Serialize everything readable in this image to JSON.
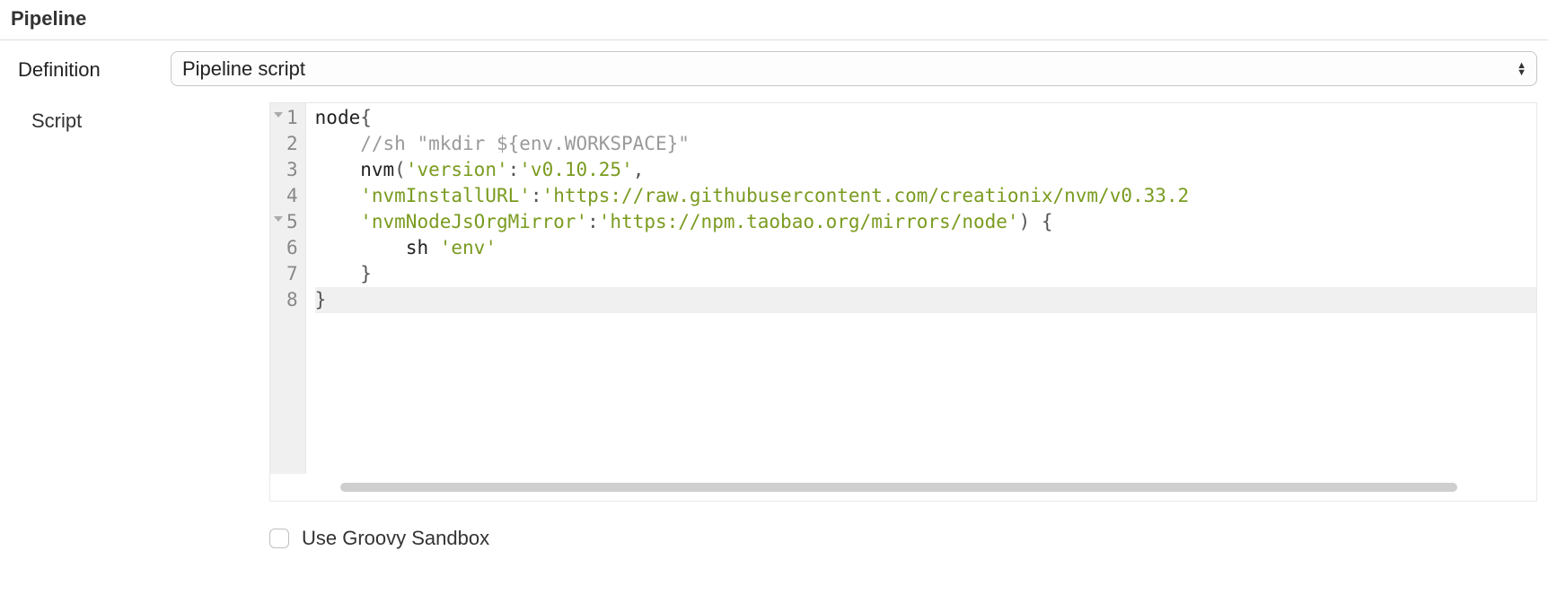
{
  "section": {
    "title": "Pipeline"
  },
  "definition": {
    "label": "Definition",
    "selected": "Pipeline script",
    "options": [
      "Pipeline script"
    ]
  },
  "script": {
    "label": "Script",
    "active_line": 8,
    "lines": [
      {
        "n": 1,
        "fold": true,
        "tokens": [
          {
            "t": "node",
            "c": "tok-kw"
          },
          {
            "t": "{",
            "c": "tok-punc"
          }
        ]
      },
      {
        "n": 2,
        "fold": false,
        "tokens": [
          {
            "t": "    ",
            "c": "tok-plain"
          },
          {
            "t": "//sh \"mkdir ${env.WORKSPACE}\"",
            "c": "tok-comment"
          }
        ]
      },
      {
        "n": 3,
        "fold": false,
        "tokens": [
          {
            "t": "    ",
            "c": "tok-plain"
          },
          {
            "t": "nvm",
            "c": "tok-call"
          },
          {
            "t": "(",
            "c": "tok-punc"
          },
          {
            "t": "'version'",
            "c": "tok-str"
          },
          {
            "t": ":",
            "c": "tok-punc"
          },
          {
            "t": "'v0.10.25'",
            "c": "tok-str"
          },
          {
            "t": ",",
            "c": "tok-punc"
          }
        ]
      },
      {
        "n": 4,
        "fold": false,
        "tokens": [
          {
            "t": "    ",
            "c": "tok-plain"
          },
          {
            "t": "'nvmInstallURL'",
            "c": "tok-str"
          },
          {
            "t": ":",
            "c": "tok-punc"
          },
          {
            "t": "'https://raw.githubusercontent.com/creationix/nvm/v0.33.2",
            "c": "tok-str"
          }
        ]
      },
      {
        "n": 5,
        "fold": true,
        "tokens": [
          {
            "t": "    ",
            "c": "tok-plain"
          },
          {
            "t": "'nvmNodeJsOrgMirror'",
            "c": "tok-str"
          },
          {
            "t": ":",
            "c": "tok-punc"
          },
          {
            "t": "'https://npm.taobao.org/mirrors/node'",
            "c": "tok-str"
          },
          {
            "t": ")",
            "c": "tok-punc"
          },
          {
            "t": " ",
            "c": "tok-plain"
          },
          {
            "t": "{",
            "c": "tok-punc"
          }
        ]
      },
      {
        "n": 6,
        "fold": false,
        "tokens": [
          {
            "t": "        ",
            "c": "tok-plain"
          },
          {
            "t": "sh ",
            "c": "tok-call"
          },
          {
            "t": "'env'",
            "c": "tok-str"
          }
        ]
      },
      {
        "n": 7,
        "fold": false,
        "tokens": [
          {
            "t": "    ",
            "c": "tok-plain"
          },
          {
            "t": "}",
            "c": "tok-punc"
          }
        ]
      },
      {
        "n": 8,
        "fold": false,
        "tokens": [
          {
            "t": "}",
            "c": "tok-punc"
          }
        ]
      }
    ]
  },
  "sandbox": {
    "label": "Use Groovy Sandbox",
    "checked": false
  }
}
